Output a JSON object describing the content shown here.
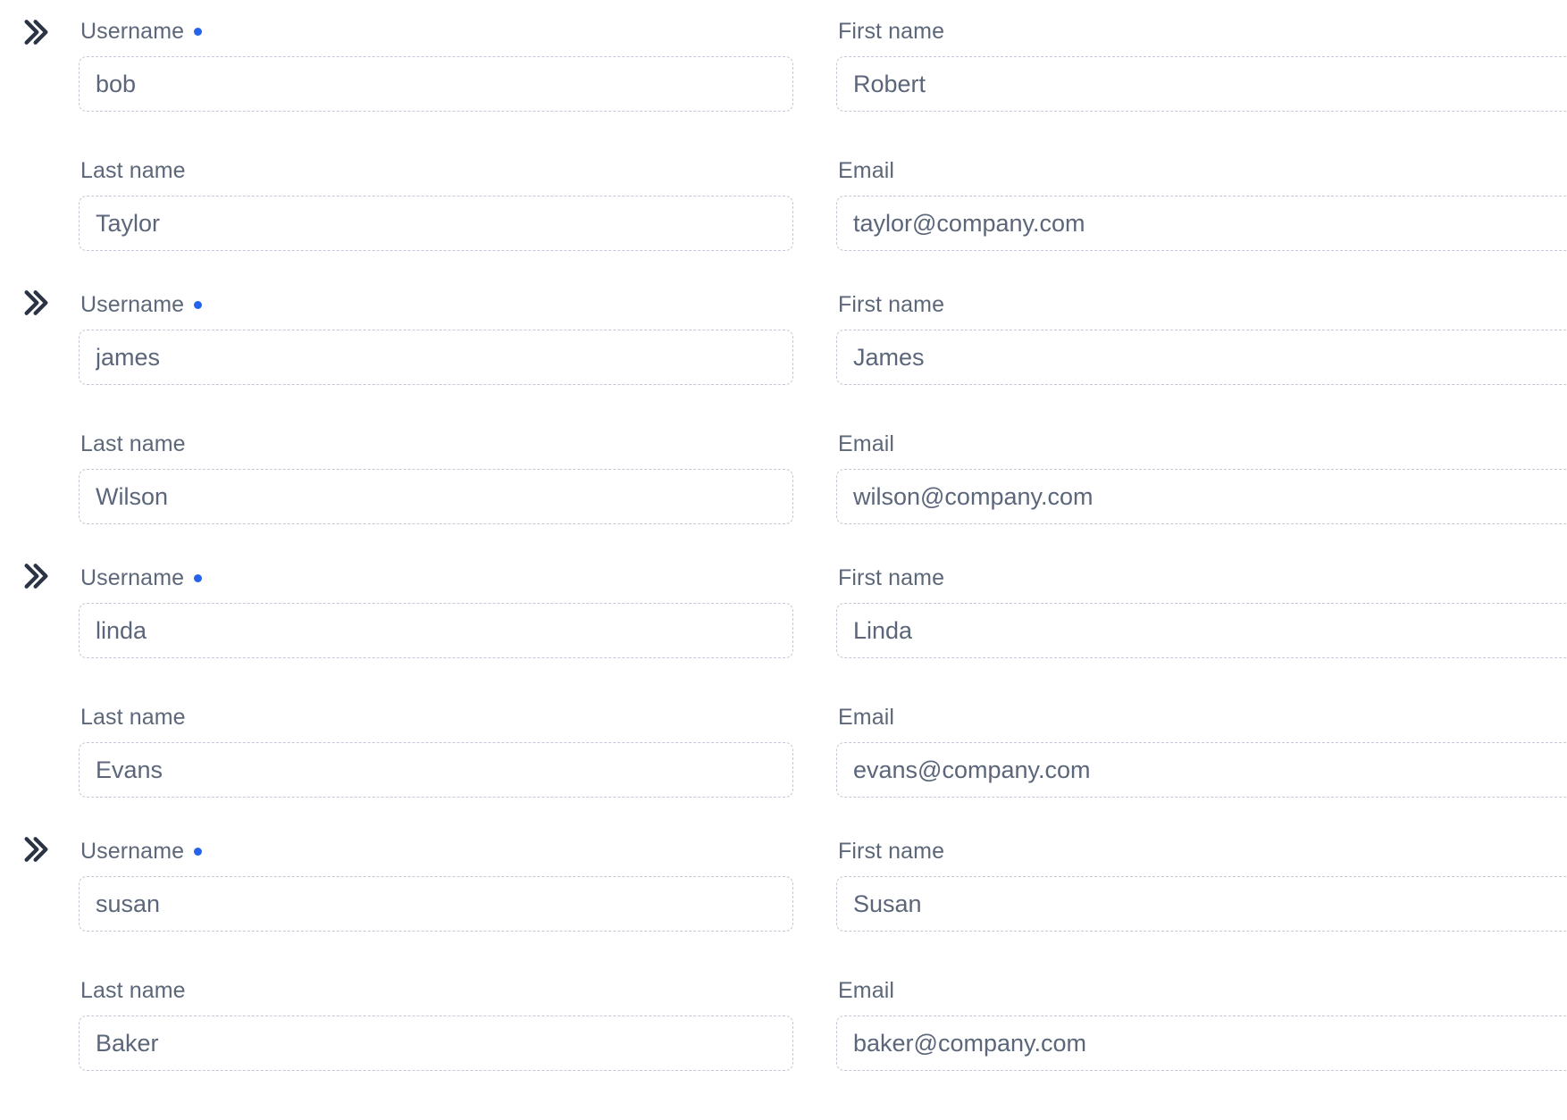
{
  "labels": {
    "username": "Username",
    "first_name": "First name",
    "last_name": "Last name",
    "email": "Email"
  },
  "icons": {
    "expand": "chevron-double-right-icon"
  },
  "colors": {
    "required_dot": "#2563eb",
    "label_text": "#5c6779",
    "value_text": "#5b667a",
    "field_border": "#c3c9d6",
    "chevron": "#2b3445",
    "background": "#ffffff"
  },
  "records": [
    {
      "username": "bob",
      "first_name": "Robert",
      "last_name": "Taylor",
      "email": "taylor@company.com"
    },
    {
      "username": "james",
      "first_name": "James",
      "last_name": "Wilson",
      "email": "wilson@company.com"
    },
    {
      "username": "linda",
      "first_name": "Linda",
      "last_name": "Evans",
      "email": "evans@company.com"
    },
    {
      "username": "susan",
      "first_name": "Susan",
      "last_name": "Baker",
      "email": "baker@company.com"
    }
  ]
}
